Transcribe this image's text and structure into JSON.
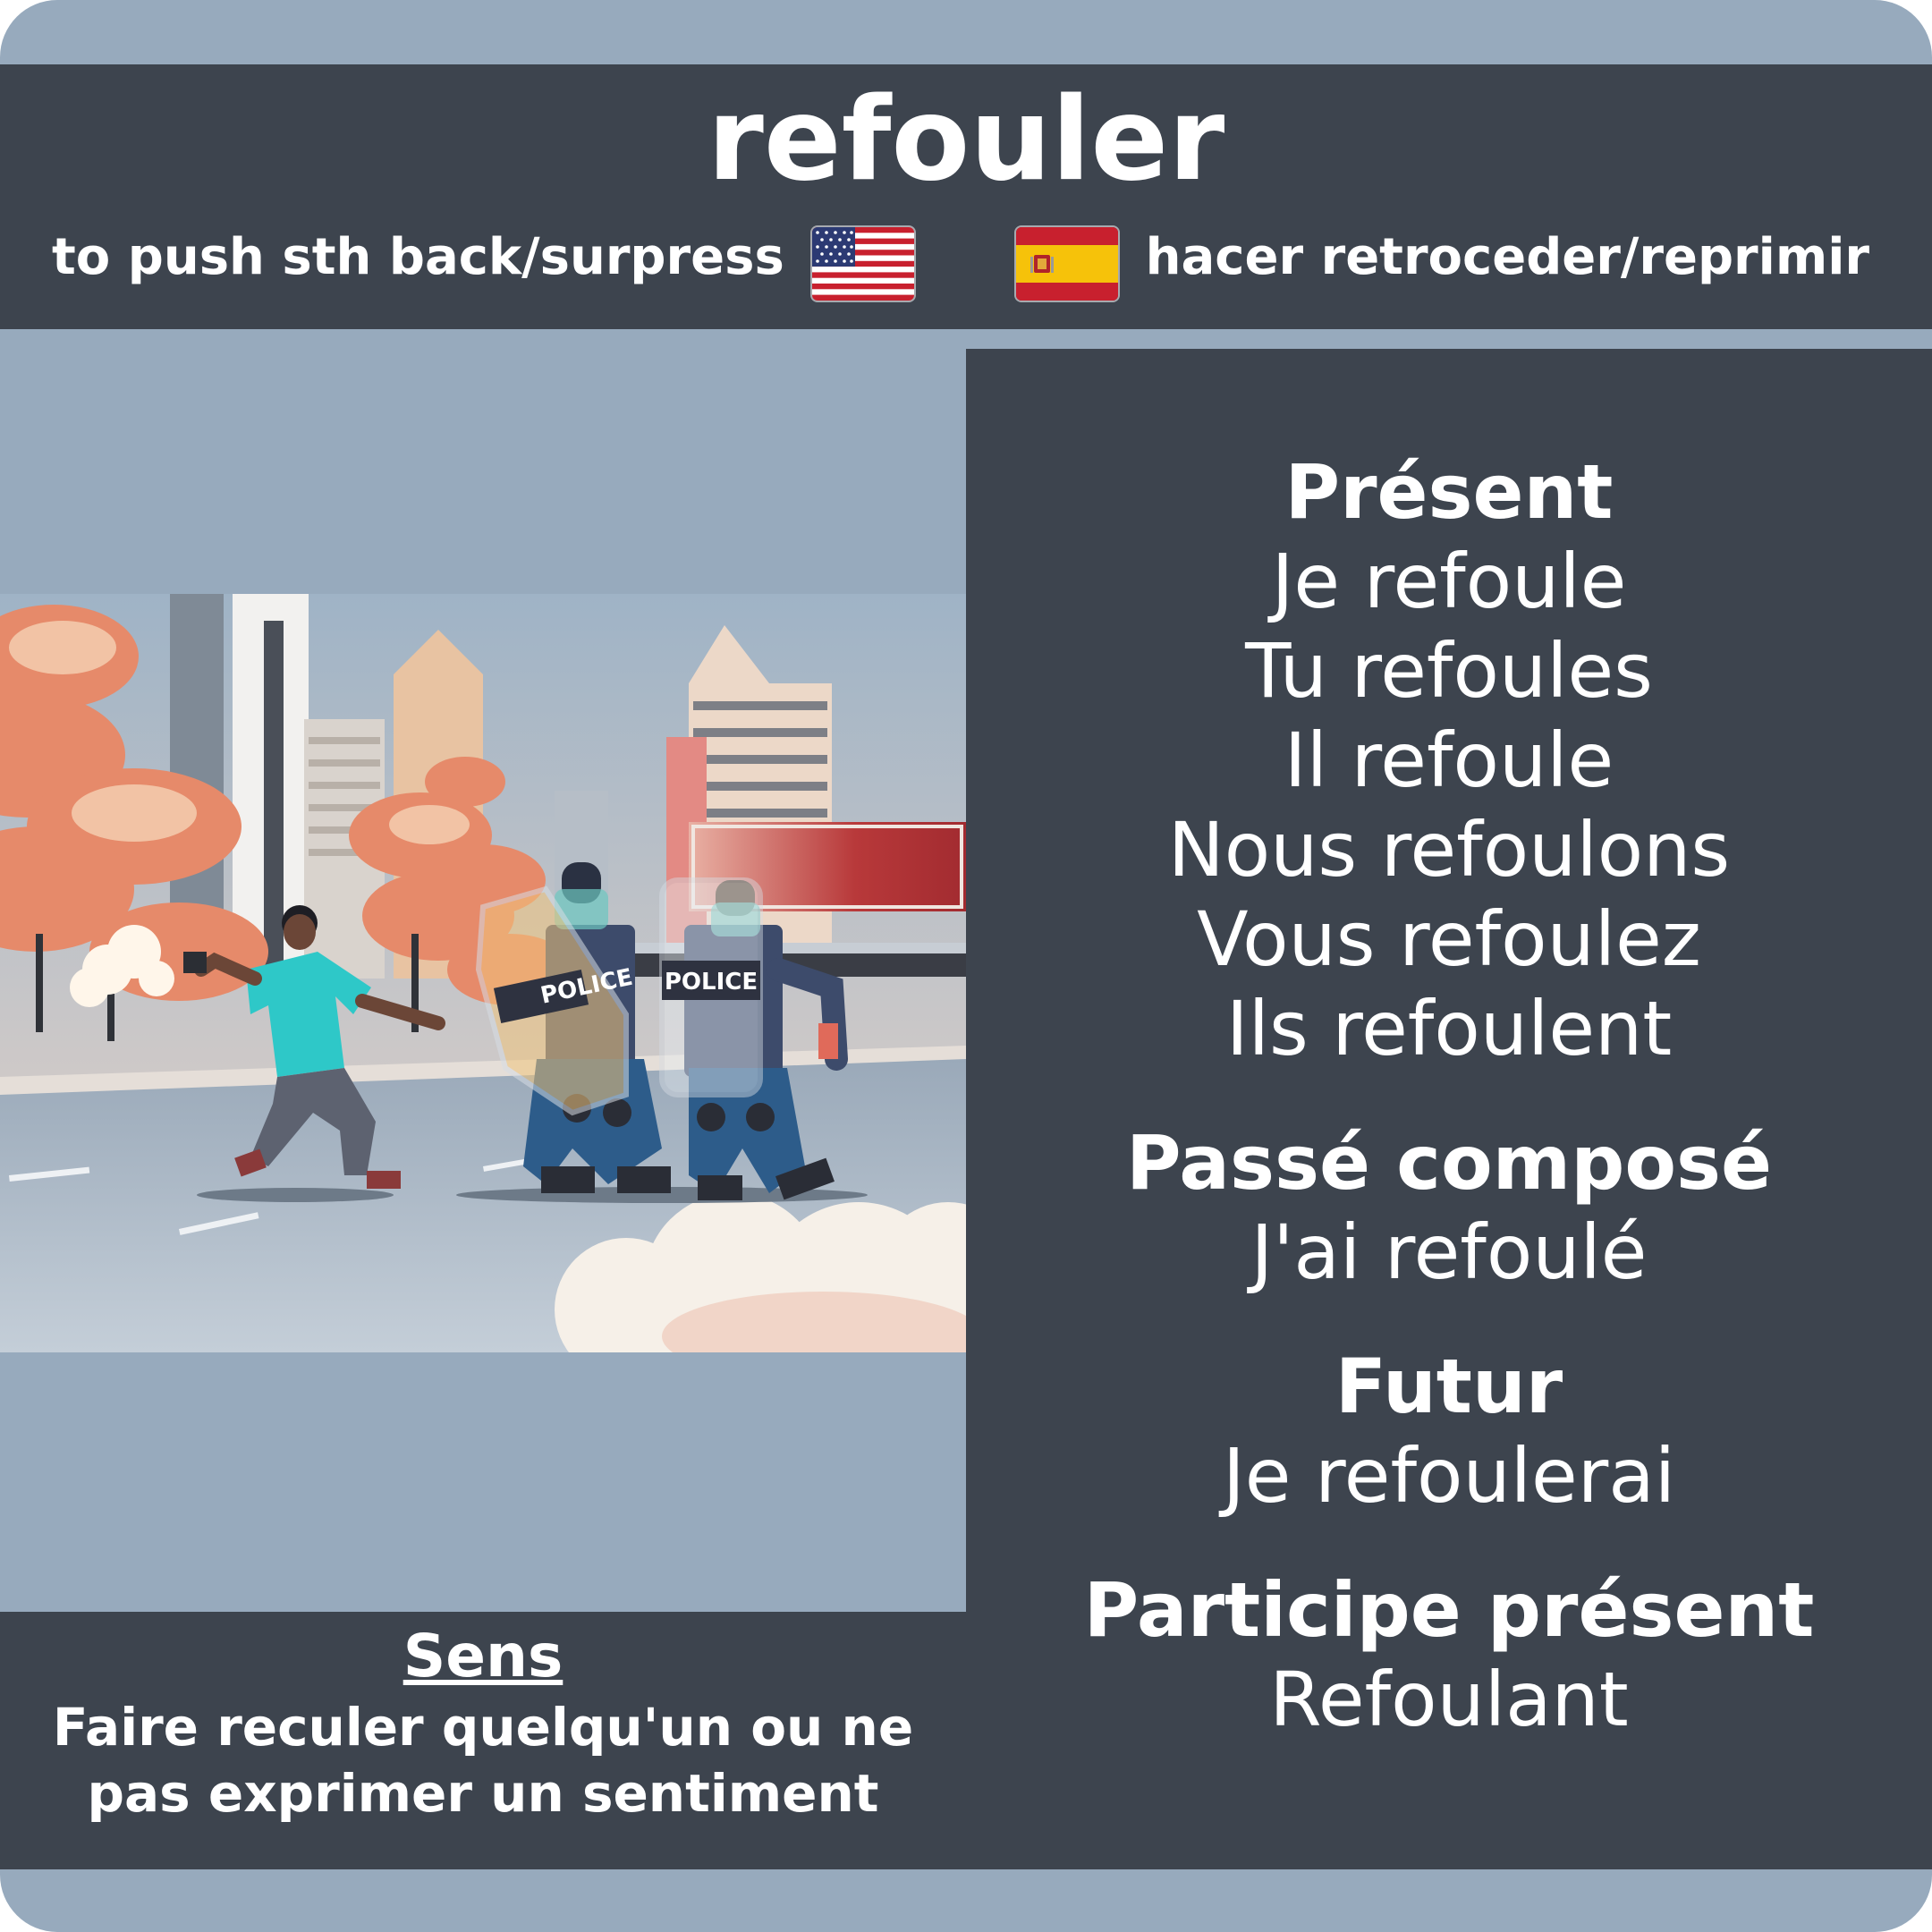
{
  "card": {
    "word": "refouler",
    "translation_en": "to push sth back/surpress",
    "translation_es": "hacer retroceder/reprimir",
    "flag_en_icon": "us-flag-icon",
    "flag_es_icon": "spain-flag-icon"
  },
  "illustration": {
    "shield_left": "POLICE",
    "shield_right": "POLICE"
  },
  "sens": {
    "title": "Sens",
    "line1": "Faire reculer quelqu'un ou ne",
    "line2": "pas exprimer un sentiment"
  },
  "conjugation": {
    "present": {
      "title": "Présent",
      "forms": [
        "Je refoule",
        "Tu refoules",
        "Il refoule",
        "Nous refoulons",
        "Vous refoulez",
        "Ils refoulent"
      ]
    },
    "passe_compose": {
      "title": "Passé composé",
      "form": "J'ai refoulé"
    },
    "futur": {
      "title": "Futur",
      "form": "Je refoulerai"
    },
    "participe_present": {
      "title": "Participe présent",
      "form": "Refoulant"
    }
  },
  "colors": {
    "panel": "#3d444e",
    "background": "#97aabd",
    "accent_tree": "#e68a6a",
    "accent_shirt": "#2ec8c8"
  }
}
